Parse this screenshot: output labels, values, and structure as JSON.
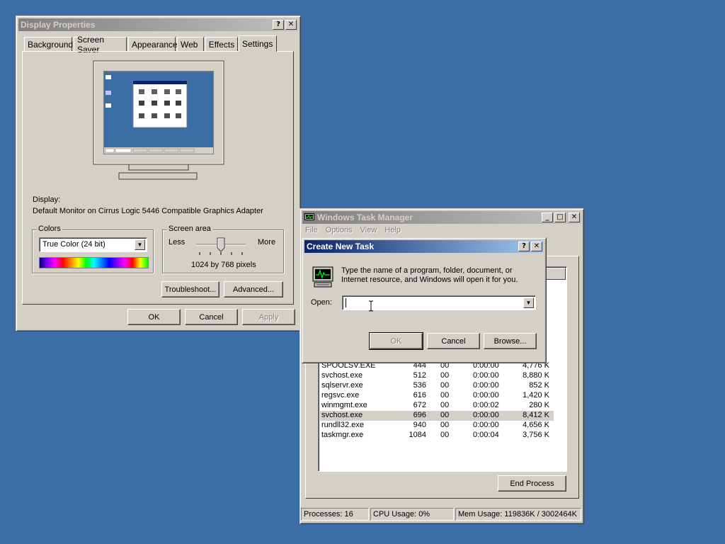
{
  "display_properties": {
    "title": "Display Properties",
    "tabs": [
      "Background",
      "Screen Saver",
      "Appearance",
      "Web",
      "Effects",
      "Settings"
    ],
    "display_label": "Display:",
    "display_value": "Default Monitor on Cirrus Logic 5446 Compatible Graphics Adapter",
    "colors_label": "Colors",
    "colors_value": "True Color (24 bit)",
    "screen_area_label": "Screen area",
    "less_label": "Less",
    "more_label": "More",
    "resolution": "1024 by 768 pixels",
    "troubleshoot_label": "Troubleshoot...",
    "advanced_label": "Advanced...",
    "ok_label": "OK",
    "cancel_label": "Cancel",
    "apply_label": "Apply"
  },
  "task_manager": {
    "title": "Windows Task Manager",
    "menu": [
      "File",
      "Options",
      "View",
      "Help"
    ],
    "header_partial": "e",
    "processes": [
      {
        "name": "SPOOLSV.EXE",
        "pid": "444",
        "cpu": "00",
        "time": "0:00:00",
        "mem": "4,776 K"
      },
      {
        "name": "svchost.exe",
        "pid": "512",
        "cpu": "00",
        "time": "0:00:00",
        "mem": "8,880 K"
      },
      {
        "name": "sqlservr.exe",
        "pid": "536",
        "cpu": "00",
        "time": "0:00:00",
        "mem": "852 K"
      },
      {
        "name": "regsvc.exe",
        "pid": "616",
        "cpu": "00",
        "time": "0:00:00",
        "mem": "1,420 K"
      },
      {
        "name": "winmgmt.exe",
        "pid": "672",
        "cpu": "00",
        "time": "0:00:02",
        "mem": "280 K"
      },
      {
        "name": "svchost.exe",
        "pid": "696",
        "cpu": "00",
        "time": "0:00:00",
        "mem": "8,412 K"
      },
      {
        "name": "rundll32.exe",
        "pid": "940",
        "cpu": "00",
        "time": "0:00:00",
        "mem": "4,656 K"
      },
      {
        "name": "taskmgr.exe",
        "pid": "1084",
        "cpu": "00",
        "time": "0:00:04",
        "mem": "3,756 K"
      }
    ],
    "end_process_label": "End Process",
    "status_processes": "Processes: 16",
    "status_cpu": "CPU Usage: 0%",
    "status_mem": "Mem Usage: 119836K / 3002464K"
  },
  "create_task": {
    "title": "Create New Task",
    "message_line1": "Type the name of a program, folder, document, or",
    "message_line2": "Internet resource, and Windows will open it for you.",
    "open_label": "Open:",
    "open_value": "",
    "ok_label": "OK",
    "cancel_label": "Cancel",
    "browse_label": "Browse..."
  },
  "icons": {
    "help": "?",
    "close": "✕",
    "minimize": "_",
    "maximize": "□",
    "dropdown": "▼"
  },
  "colors": {
    "desktop": "#3a6ea5",
    "active_title": "#0a246a",
    "inactive_title": "#808080",
    "face": "#d4d0c8"
  }
}
